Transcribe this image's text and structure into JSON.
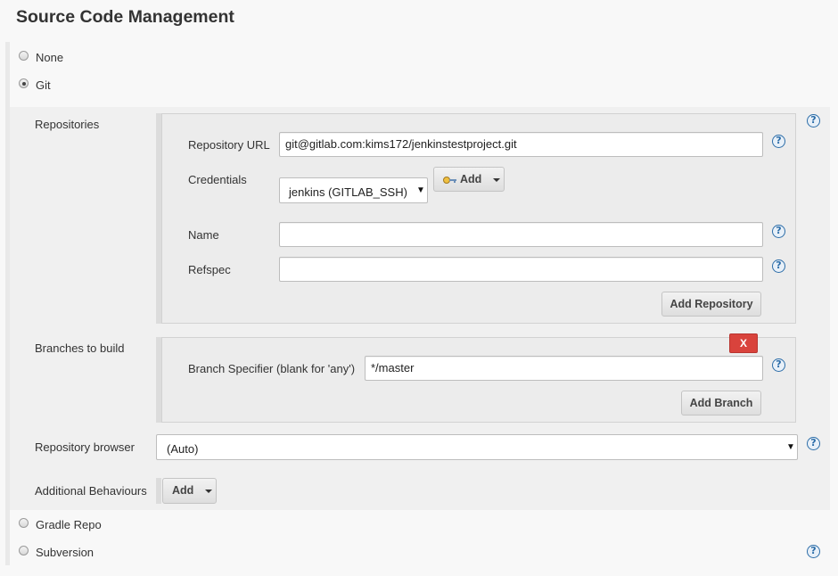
{
  "page": {
    "title": "Source Code Management"
  },
  "scm_options": {
    "none": "None",
    "git": "Git",
    "gradle_repo": "Gradle Repo",
    "subversion": "Subversion"
  },
  "git": {
    "repositories_label": "Repositories",
    "repository_url_label": "Repository URL",
    "repository_url_value": "git@gitlab.com:kims172/jenkinstestproject.git",
    "credentials_label": "Credentials",
    "credentials_selected": "jenkins (GITLAB_SSH)",
    "add_credentials_label": "Add",
    "name_label": "Name",
    "name_value": "",
    "refspec_label": "Refspec",
    "refspec_value": "",
    "add_repository_label": "Add Repository",
    "branches_label": "Branches to build",
    "delete_branch_label": "X",
    "branch_specifier_label": "Branch Specifier (blank for 'any')",
    "branch_specifier_value": "*/master",
    "add_branch_label": "Add Branch",
    "repository_browser_label": "Repository browser",
    "repository_browser_selected": "(Auto)",
    "additional_behaviours_label": "Additional Behaviours",
    "add_behaviour_label": "Add"
  },
  "icons": {
    "help": "help-icon",
    "key": "key-icon",
    "radio": "radio-button"
  },
  "colors": {
    "help_blue": "#2c6da8",
    "delete_red": "#d9433c",
    "background": "#f8f8f8",
    "section_bg": "#f0f0f0"
  }
}
